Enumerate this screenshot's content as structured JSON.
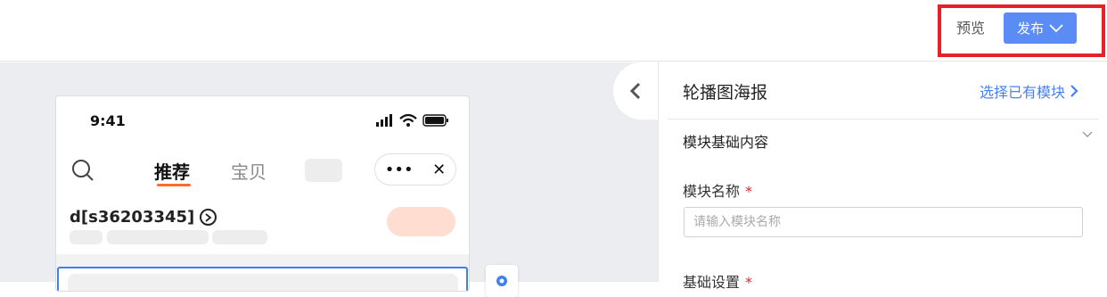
{
  "toolbar": {
    "preview_label": "预览",
    "publish_label": "发布",
    "accent_color": "#5b8cf6",
    "highlight_color": "#e8202a"
  },
  "phone": {
    "status_time": "9:41",
    "tabs": [
      "推荐",
      "宝贝"
    ],
    "shop_name": "d[s36203345]",
    "capsule_more": "•••",
    "capsule_close": "✕"
  },
  "panel": {
    "title": "轮播图海报",
    "select_module_link": "选择已有模块",
    "section_title": "模块基础内容",
    "field_name_label": "模块名称",
    "field_name_required": "*",
    "field_name_placeholder": "请输入模块名称",
    "basic_settings_label": "基础设置",
    "basic_settings_required": "*"
  }
}
